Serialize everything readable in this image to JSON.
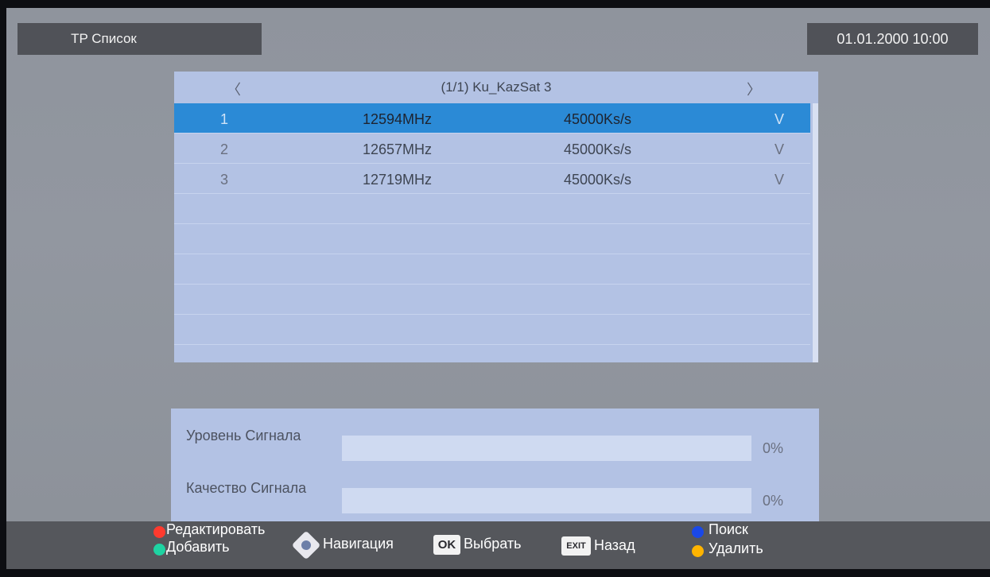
{
  "header": {
    "title": "TP Список",
    "datetime": "01.01.2000 10:00"
  },
  "list": {
    "nav_left": "〈",
    "nav_right": "〉",
    "title": "(1/1) Ku_KazSat 3",
    "rows": [
      {
        "num": "1",
        "freq": "12594MHz",
        "rate": "45000Ks/s",
        "pol": "V",
        "selected": true
      },
      {
        "num": "2",
        "freq": "12657MHz",
        "rate": "45000Ks/s",
        "pol": "V",
        "selected": false
      },
      {
        "num": "3",
        "freq": "12719MHz",
        "rate": "45000Ks/s",
        "pol": "V",
        "selected": false
      },
      {
        "num": "",
        "freq": "",
        "rate": "",
        "pol": "",
        "selected": false
      },
      {
        "num": "",
        "freq": "",
        "rate": "",
        "pol": "",
        "selected": false
      },
      {
        "num": "",
        "freq": "",
        "rate": "",
        "pol": "",
        "selected": false
      },
      {
        "num": "",
        "freq": "",
        "rate": "",
        "pol": "",
        "selected": false
      },
      {
        "num": "",
        "freq": "",
        "rate": "",
        "pol": "",
        "selected": false
      }
    ]
  },
  "signal": {
    "level_label": "Уровень Сигнала",
    "level_value": "0%",
    "level_fraction": 0,
    "quality_label": "Качество Сигнала",
    "quality_value": "0%",
    "quality_fraction": 0
  },
  "footer": {
    "edit": "Редактировать",
    "add": "Добавить",
    "navigation": "Навигация",
    "ok_key": "OK",
    "select": "Выбрать",
    "exit_key": "EXIT",
    "back": "Назад",
    "search": "Поиск",
    "delete": "Удалить"
  },
  "colors": {
    "red": "#ff3a2e",
    "green": "#1ed3a2",
    "blue": "#1a48e8",
    "yellow": "#ffb400",
    "highlight": "#2b8ad6"
  },
  "icons": {
    "navigation": "dpad-icon"
  }
}
